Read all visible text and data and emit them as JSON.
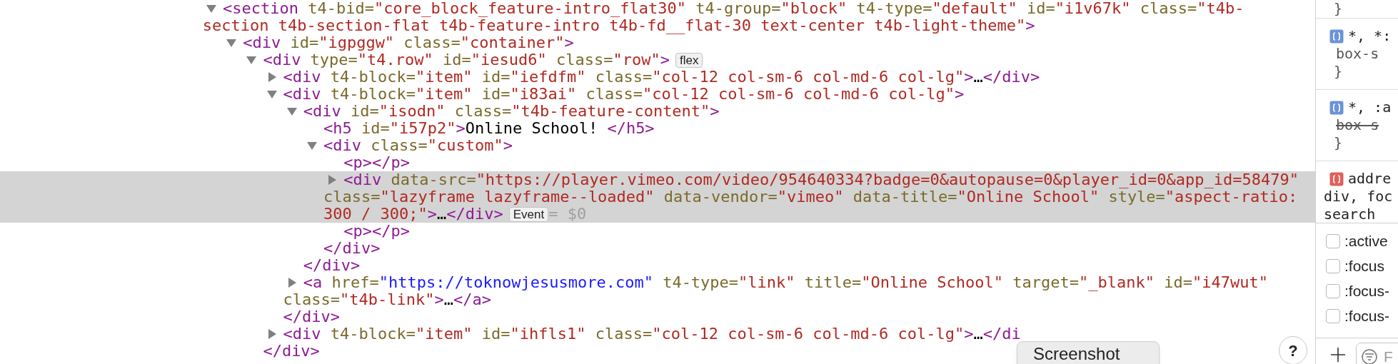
{
  "elements_panel": {
    "dom_tree": [
      {
        "kind": "toggle",
        "expanded": true,
        "selected": false,
        "lines": [
          [
            {
              "kind": "tag",
              "text": "<section"
            },
            {
              "kind": "attr",
              "text": " t4-bid="
            },
            {
              "kind": "value",
              "text": "\"core_block_feature-intro_flat30\""
            },
            {
              "kind": "attr",
              "text": " t4-group="
            },
            {
              "kind": "value",
              "text": "\"block\""
            },
            {
              "kind": "attr",
              "text": " t4-type="
            },
            {
              "kind": "value",
              "text": "\"default\""
            },
            {
              "kind": "attr",
              "text": " id="
            },
            {
              "kind": "value",
              "text": "\"i1v67k\""
            },
            {
              "kind": "attr",
              "text": " class="
            },
            {
              "kind": "value",
              "text": "\"t4b-"
            }
          ],
          [
            {
              "kind": "value",
              "text": "section t4b-section-flat t4b-feature-intro t4b-fd__flat-30 text-center t4b-light-theme\""
            },
            {
              "kind": "tag",
              "text": ">"
            }
          ]
        ],
        "children": [
          {
            "kind": "toggle",
            "expanded": true,
            "selected": false,
            "lines": [
              [
                {
                  "kind": "tag",
                  "text": "<div"
                },
                {
                  "kind": "attr",
                  "text": " id="
                },
                {
                  "kind": "value",
                  "text": "\"igpggw\""
                },
                {
                  "kind": "attr",
                  "text": " class="
                },
                {
                  "kind": "value",
                  "text": "\"container\""
                },
                {
                  "kind": "tag",
                  "text": ">"
                }
              ]
            ],
            "children": [
              {
                "kind": "toggle",
                "expanded": true,
                "selected": false,
                "badges": [
                  "flex"
                ],
                "lines": [
                  [
                    {
                      "kind": "tag",
                      "text": "<div"
                    },
                    {
                      "kind": "attr",
                      "text": " type="
                    },
                    {
                      "kind": "value",
                      "text": "\"t4.row\""
                    },
                    {
                      "kind": "attr",
                      "text": " id="
                    },
                    {
                      "kind": "value",
                      "text": "\"iesud6\""
                    },
                    {
                      "kind": "attr",
                      "text": " class="
                    },
                    {
                      "kind": "value",
                      "text": "\"row\""
                    },
                    {
                      "kind": "tag",
                      "text": ">"
                    }
                  ]
                ],
                "close": [
                  {
                    "kind": "tag",
                    "text": "</div>"
                  }
                ],
                "children": [
                  {
                    "kind": "toggle",
                    "expanded": false,
                    "selected": false,
                    "lines": [
                      [
                        {
                          "kind": "tag",
                          "text": "<div"
                        },
                        {
                          "kind": "attr",
                          "text": " t4-block="
                        },
                        {
                          "kind": "value",
                          "text": "\"item\""
                        },
                        {
                          "kind": "attr",
                          "text": " id="
                        },
                        {
                          "kind": "value",
                          "text": "\"iefdfm\""
                        },
                        {
                          "kind": "attr",
                          "text": " class="
                        },
                        {
                          "kind": "value",
                          "text": "\"col-12 col-sm-6 col-md-6 col-lg\""
                        },
                        {
                          "kind": "tag",
                          "text": ">"
                        },
                        {
                          "kind": "text",
                          "text": "…"
                        },
                        {
                          "kind": "tag",
                          "text": "</div>"
                        }
                      ]
                    ]
                  },
                  {
                    "kind": "toggle",
                    "expanded": true,
                    "selected": false,
                    "lines": [
                      [
                        {
                          "kind": "tag",
                          "text": "<div"
                        },
                        {
                          "kind": "attr",
                          "text": " t4-block="
                        },
                        {
                          "kind": "value",
                          "text": "\"item\""
                        },
                        {
                          "kind": "attr",
                          "text": " id="
                        },
                        {
                          "kind": "value",
                          "text": "\"i83ai\""
                        },
                        {
                          "kind": "attr",
                          "text": " class="
                        },
                        {
                          "kind": "value",
                          "text": "\"col-12 col-sm-6 col-md-6 col-lg\""
                        },
                        {
                          "kind": "tag",
                          "text": ">"
                        }
                      ]
                    ],
                    "close": [
                      {
                        "kind": "tag",
                        "text": "</div>"
                      }
                    ],
                    "children": [
                      {
                        "kind": "toggle",
                        "expanded": true,
                        "selected": false,
                        "lines": [
                          [
                            {
                              "kind": "tag",
                              "text": "<div"
                            },
                            {
                              "kind": "attr",
                              "text": " id="
                            },
                            {
                              "kind": "value",
                              "text": "\"isodn\""
                            },
                            {
                              "kind": "attr",
                              "text": " class="
                            },
                            {
                              "kind": "value",
                              "text": "\"t4b-feature-content\""
                            },
                            {
                              "kind": "tag",
                              "text": ">"
                            }
                          ]
                        ],
                        "close": [
                          {
                            "kind": "tag",
                            "text": "</div>"
                          }
                        ],
                        "children": [
                          {
                            "kind": "plain",
                            "selected": false,
                            "lines": [
                              [
                                {
                                  "kind": "tag",
                                  "text": "<h5"
                                },
                                {
                                  "kind": "attr",
                                  "text": " id="
                                },
                                {
                                  "kind": "value",
                                  "text": "\"i57p2\""
                                },
                                {
                                  "kind": "tag",
                                  "text": ">"
                                },
                                {
                                  "kind": "text",
                                  "text": "Online School! "
                                },
                                {
                                  "kind": "tag",
                                  "text": "</h5>"
                                }
                              ]
                            ]
                          },
                          {
                            "kind": "toggle",
                            "expanded": true,
                            "selected": false,
                            "lines": [
                              [
                                {
                                  "kind": "tag",
                                  "text": "<div"
                                },
                                {
                                  "kind": "attr",
                                  "text": " class="
                                },
                                {
                                  "kind": "value",
                                  "text": "\"custom\""
                                },
                                {
                                  "kind": "tag",
                                  "text": ">"
                                }
                              ]
                            ],
                            "close": [
                              {
                                "kind": "tag",
                                "text": "</div>"
                              }
                            ],
                            "children": [
                              {
                                "kind": "plain",
                                "selected": false,
                                "lines": [
                                  [
                                    {
                                      "kind": "tag",
                                      "text": "<p></p>"
                                    }
                                  ]
                                ]
                              },
                              {
                                "kind": "toggle",
                                "expanded": false,
                                "selected": true,
                                "badges": [
                                  "Event"
                                ],
                                "reference": "= $0",
                                "lines": [
                                  [
                                    {
                                      "kind": "tag",
                                      "text": "<div"
                                    },
                                    {
                                      "kind": "attr",
                                      "text": " data-src="
                                    },
                                    {
                                      "kind": "value",
                                      "text": "\"https://player.vimeo.com/video/954640334?badge=0&autopause=0&player_id=0&app_id=58479\""
                                    }
                                  ],
                                  [
                                    {
                                      "kind": "attr",
                                      "text": "class="
                                    },
                                    {
                                      "kind": "value",
                                      "text": "\"lazyframe lazyframe--loaded\""
                                    },
                                    {
                                      "kind": "attr",
                                      "text": " data-vendor="
                                    },
                                    {
                                      "kind": "value",
                                      "text": "\"vimeo\""
                                    },
                                    {
                                      "kind": "attr",
                                      "text": " data-title="
                                    },
                                    {
                                      "kind": "value",
                                      "text": "\"Online School\""
                                    },
                                    {
                                      "kind": "attr",
                                      "text": " style="
                                    },
                                    {
                                      "kind": "value",
                                      "text": "\"aspect-ratio:"
                                    }
                                  ],
                                  [
                                    {
                                      "kind": "value",
                                      "text": "300 / 300;\""
                                    },
                                    {
                                      "kind": "tag",
                                      "text": ">"
                                    },
                                    {
                                      "kind": "text",
                                      "text": "…"
                                    },
                                    {
                                      "kind": "tag",
                                      "text": "</div>"
                                    }
                                  ]
                                ]
                              },
                              {
                                "kind": "plain",
                                "selected": false,
                                "lines": [
                                  [
                                    {
                                      "kind": "tag",
                                      "text": "<p></p>"
                                    }
                                  ]
                                ]
                              }
                            ]
                          }
                        ]
                      },
                      {
                        "kind": "toggle",
                        "expanded": false,
                        "selected": false,
                        "lines": [
                          [
                            {
                              "kind": "tag",
                              "text": "<a"
                            },
                            {
                              "kind": "attr",
                              "text": " href="
                            },
                            {
                              "kind": "link",
                              "text": "\"https://toknowjesusmore.com\""
                            },
                            {
                              "kind": "attr",
                              "text": " t4-type="
                            },
                            {
                              "kind": "value",
                              "text": "\"link\""
                            },
                            {
                              "kind": "attr",
                              "text": " title="
                            },
                            {
                              "kind": "value",
                              "text": "\"Online School\""
                            },
                            {
                              "kind": "attr",
                              "text": " target="
                            },
                            {
                              "kind": "value",
                              "text": "\"_blank\""
                            },
                            {
                              "kind": "attr",
                              "text": " id="
                            },
                            {
                              "kind": "value",
                              "text": "\"i47wut\""
                            }
                          ],
                          [
                            {
                              "kind": "attr",
                              "text": "class="
                            },
                            {
                              "kind": "value",
                              "text": "\"t4b-link\""
                            },
                            {
                              "kind": "tag",
                              "text": ">"
                            },
                            {
                              "kind": "text",
                              "text": "…"
                            },
                            {
                              "kind": "tag",
                              "text": "</a>"
                            }
                          ]
                        ]
                      }
                    ]
                  },
                  {
                    "kind": "toggle",
                    "expanded": false,
                    "selected": false,
                    "lines": [
                      [
                        {
                          "kind": "tag",
                          "text": "<div"
                        },
                        {
                          "kind": "attr",
                          "text": " t4-block="
                        },
                        {
                          "kind": "value",
                          "text": "\"item\""
                        },
                        {
                          "kind": "attr",
                          "text": " id="
                        },
                        {
                          "kind": "value",
                          "text": "\"ihfls1\""
                        },
                        {
                          "kind": "attr",
                          "text": " class="
                        },
                        {
                          "kind": "value",
                          "text": "\"col-12 col-sm-6 col-md-6 col-lg\""
                        },
                        {
                          "kind": "tag",
                          "text": ">"
                        },
                        {
                          "kind": "text",
                          "text": "…"
                        },
                        {
                          "kind": "tag",
                          "text": "</di"
                        }
                      ]
                    ]
                  }
                ]
              }
            ]
          }
        ]
      }
    ]
  },
  "styles_sidebar": {
    "leading_brace": "}",
    "rules": [
      {
        "color": "#6b93d6",
        "selector_lines": [
          "*, *:"
        ],
        "properties": [
          {
            "text": "box-s",
            "overridden": false
          }
        ],
        "close": "}"
      },
      {
        "color": "#6b93d6",
        "selector_lines": [
          "*, :a"
        ],
        "properties": [
          {
            "text": "box-s",
            "overridden": true
          }
        ],
        "close": "}"
      },
      {
        "color": "#e0605a",
        "selector_lines": [
          "addre",
          "div, foc",
          "search"
        ]
      }
    ],
    "state_toggles": [
      {
        "label": ":active",
        "checked": false
      },
      {
        "label": ":focus",
        "checked": false
      },
      {
        "label": ":focus-",
        "checked": false
      },
      {
        "label": ":focus-",
        "checked": false
      }
    ],
    "filter": {
      "placeholder": "F"
    }
  },
  "help_button": {
    "label": "?"
  },
  "tooltip": {
    "text": "Screenshot"
  }
}
